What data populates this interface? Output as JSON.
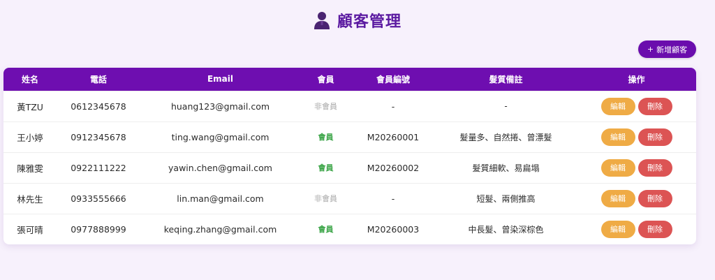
{
  "header": {
    "title": "顧客管理",
    "icon": "user-icon"
  },
  "toolbar": {
    "add_label": "新增顧客",
    "add_icon": "+"
  },
  "table": {
    "columns": [
      "姓名",
      "電話",
      "Email",
      "會員",
      "會員編號",
      "髮質備註",
      "操作"
    ],
    "rows": [
      {
        "name": "黃TZU",
        "phone": "0612345678",
        "email": "huang123@gmail.com",
        "member": "非會員",
        "is_member": false,
        "member_no": "-",
        "memo": "-"
      },
      {
        "name": "王小婷",
        "phone": "0912345678",
        "email": "ting.wang@gmail.com",
        "member": "會員",
        "is_member": true,
        "member_no": "M20260001",
        "memo": "髮量多、自然捲、曾漂髮"
      },
      {
        "name": "陳雅雯",
        "phone": "0922111222",
        "email": "yawin.chen@gmail.com",
        "member": "會員",
        "is_member": true,
        "member_no": "M20260002",
        "memo": "髮質細軟、易扁塌"
      },
      {
        "name": "林先生",
        "phone": "0933555666",
        "email": "lin.man@gmail.com",
        "member": "非會員",
        "is_member": false,
        "member_no": "-",
        "memo": "短髮、兩側推高"
      },
      {
        "name": "張可晴",
        "phone": "0977888999",
        "email": "keqing.zhang@gmail.com",
        "member": "會員",
        "is_member": true,
        "member_no": "M20260003",
        "memo": "中長髮、曾染深棕色"
      }
    ],
    "edit_label": "編輯",
    "delete_label": "刪除"
  },
  "colors": {
    "accent": "#6e0eb0",
    "title": "#5b1aa1",
    "member": "#3ea64a",
    "non_member": "#a8a8a8",
    "edit": "#efab45",
    "delete": "#dc5454",
    "background": "#f7f1fc"
  }
}
